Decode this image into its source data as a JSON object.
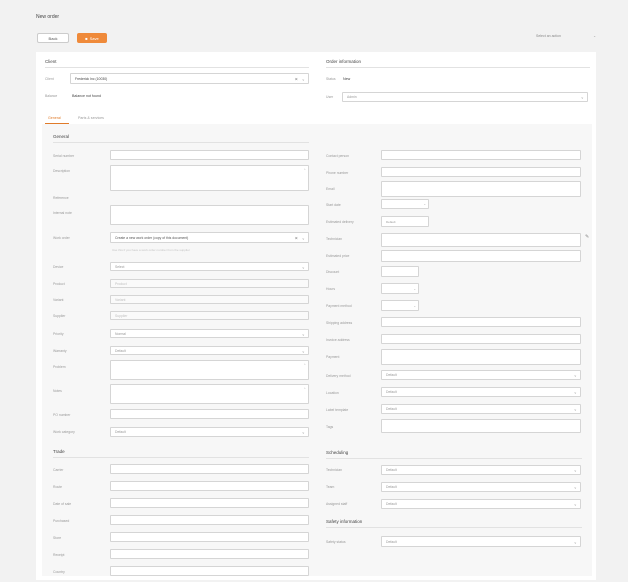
{
  "page": {
    "title": "New order"
  },
  "toolbar": {
    "back_label": "Back",
    "save_label": "Save",
    "top_select_value": "Select an action"
  },
  "client": {
    "header": "Client",
    "client_label": "Client",
    "client_value": "Frederick Inc (10030)",
    "balance_label": "Balance",
    "balance_value": "Balance not found"
  },
  "order_info": {
    "header": "Order information",
    "status_label": "Status",
    "status_value": "New",
    "user_label": "User",
    "user_value": "Admin"
  },
  "tabs": [
    {
      "label": "General"
    },
    {
      "label": "Parts & services"
    }
  ],
  "general": {
    "header": "General",
    "fields": [
      {
        "label": "Serial number"
      },
      {
        "label": "Description"
      },
      {
        "label": "Reference"
      },
      {
        "label": "Internal note"
      },
      {
        "label": "Work order",
        "value": "Create a new work order (copy of this document)"
      },
      {
        "label": "Device",
        "value": "Select"
      },
      {
        "label": "Product",
        "value": "Product"
      },
      {
        "label": "Variant",
        "value": "Variant"
      },
      {
        "label": "Supplier",
        "value": "Supplier"
      },
      {
        "label": "Priority",
        "value": "Normal"
      },
      {
        "label": "Warranty",
        "value": "Default"
      },
      {
        "label": "Problem"
      },
      {
        "label": "Notes"
      },
      {
        "label": "PO number"
      },
      {
        "label": "Work category",
        "value": "Default"
      }
    ],
    "hint": "Use this if you have a work order number from the supplier"
  },
  "right_col": {
    "fields": [
      {
        "label": "Contact person"
      },
      {
        "label": "Phone number"
      },
      {
        "label": "Email"
      },
      {
        "label": "Start date"
      },
      {
        "label": "Estimated delivery"
      },
      {
        "label": "Technician"
      },
      {
        "label": "Estimated price"
      },
      {
        "label": "Discount"
      },
      {
        "label": "Hours"
      },
      {
        "label": "Payment method"
      },
      {
        "label": "Shipping address"
      },
      {
        "label": "Invoice address"
      },
      {
        "label": "Payment"
      },
      {
        "label": "Delivery method",
        "value": "Default"
      },
      {
        "label": "Location",
        "value": "Default"
      },
      {
        "label": "Label template",
        "value": "Default"
      },
      {
        "label": "Tags"
      }
    ],
    "default_value": "Default"
  },
  "trade": {
    "header": "Trade",
    "fields": [
      {
        "label": "Carrier"
      },
      {
        "label": "Route"
      },
      {
        "label": "Date of sale"
      },
      {
        "label": "Purchased"
      },
      {
        "label": "Store"
      },
      {
        "label": "Receipt"
      },
      {
        "label": "Country"
      }
    ]
  },
  "scheduling": {
    "header": "Scheduling",
    "fields": [
      {
        "label": "Technician",
        "value": "Default"
      },
      {
        "label": "Team",
        "value": "Default"
      },
      {
        "label": "Assigned staff",
        "value": "Default"
      }
    ]
  },
  "safety": {
    "header": "Safety information",
    "fields": [
      {
        "label": "Safety status",
        "value": "Default"
      }
    ]
  }
}
